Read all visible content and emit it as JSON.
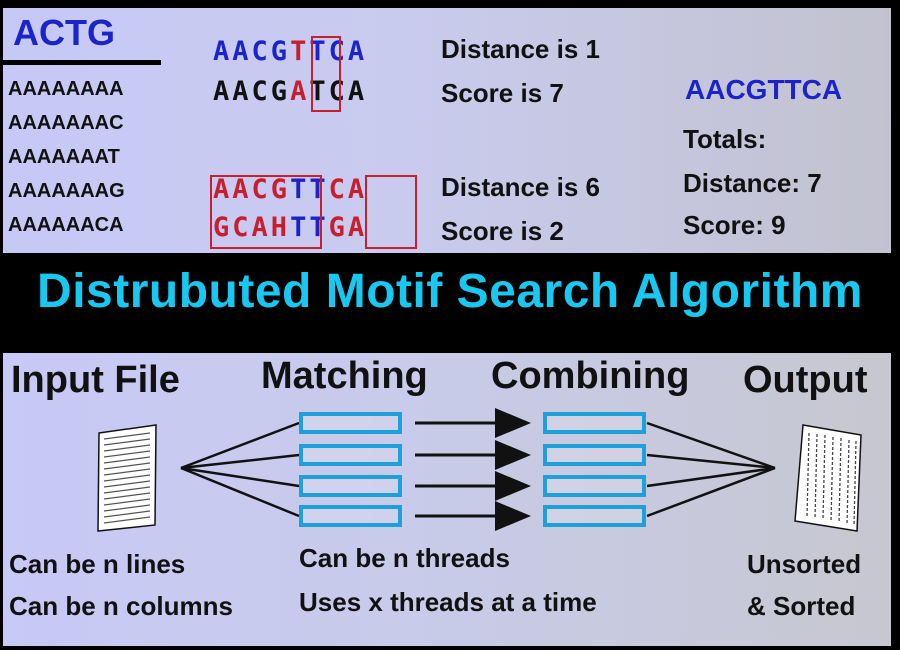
{
  "top": {
    "alphabet": "ACTG",
    "sequences": [
      "AAAAAAAA",
      "AAAAAAAC",
      "AAAAAAAT",
      "AAAAAAAG",
      "AAAAAACA"
    ],
    "example1": {
      "query": [
        "A",
        "A",
        "C",
        "G",
        "T",
        "T",
        "C",
        "A"
      ],
      "candidate": [
        "A",
        "A",
        "C",
        "G",
        "A",
        "T",
        "C",
        "A"
      ],
      "distance": "Distance is 1",
      "score": "Score is 7"
    },
    "example2": {
      "query": [
        "A",
        "A",
        "C",
        "G",
        "T",
        "T",
        "C",
        "A"
      ],
      "candidate": [
        "G",
        "C",
        "A",
        "H",
        "T",
        "T",
        "G",
        "A"
      ],
      "distance": "Distance is 6",
      "score": "Score is 2"
    },
    "motif": "AACGTTCA",
    "totals_label": "Totals:",
    "totals_distance": "Distance: 7",
    "totals_score": "Score: 9"
  },
  "banner": {
    "title": "Distrubuted Motif Search Algorithm"
  },
  "bottom": {
    "stage_input": "Input File",
    "stage_matching": "Matching",
    "stage_combining": "Combining",
    "stage_output": "Output",
    "input_note_1": "Can be n lines",
    "input_note_2": "Can be n columns",
    "thread_note_1": "Can be n threads",
    "thread_note_2": "Uses x threads at a time",
    "output_note_1": "Unsorted",
    "output_note_2": "& Sorted"
  },
  "colors": {
    "accent_blue": "#1a24c8",
    "accent_red": "#c81e2e",
    "thread_box": "#1ea0d8",
    "banner_text": "#18c8f0"
  }
}
